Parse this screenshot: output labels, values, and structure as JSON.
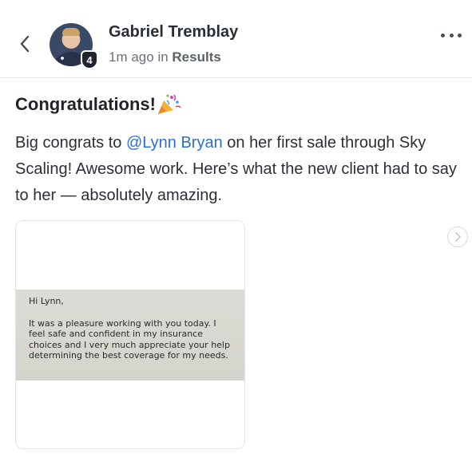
{
  "header": {
    "author_name": "Gabriel Tremblay",
    "level": "4",
    "time_ago": "1m ago",
    "in_word": "in",
    "group": "Results"
  },
  "post": {
    "title": "Congratulations!",
    "title_emoji": "party-popper-icon",
    "text_before": "Big congrats to ",
    "mention": "@Lynn Bryan",
    "text_after": " on her first sale through Sky Scaling! Awesome work. Here’s what the new client had to say to her — absolutely amazing."
  },
  "attachment": {
    "greeting": "Hi Lynn,",
    "body": "It was a pleasure working with you today. I feel safe and confident in my insurance choices and I very much appreciate your help determining the best coverage for my needs."
  },
  "icons": {
    "back": "chevron-left-icon",
    "more": "more-horizontal-icon",
    "next": "chevron-right-icon"
  },
  "colors": {
    "mention": "#2d6fd1",
    "badge_bg": "#1f2430",
    "divider": "#e6e7e9"
  }
}
